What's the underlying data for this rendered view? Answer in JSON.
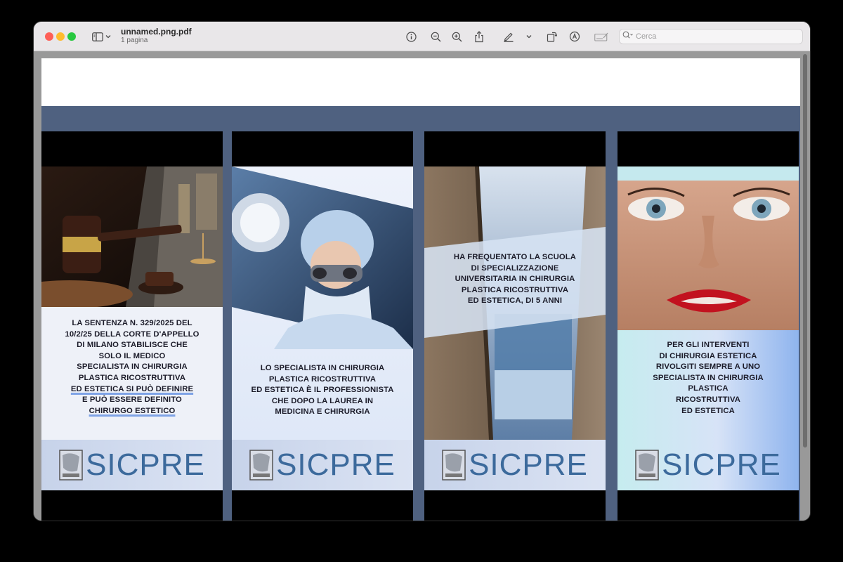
{
  "window": {
    "file_name": "unnamed.png.pdf",
    "page_count": "1 pagina",
    "search_placeholder": "Cerca"
  },
  "toolbar": {
    "icons": [
      "sidebar-icon",
      "chevron-down-icon",
      "info-icon",
      "zoom-out-icon",
      "zoom-in-icon",
      "share-icon",
      "highlight-pen-icon",
      "chevron-down-icon",
      "rotate-icon",
      "markup-icon",
      "signature-icon",
      "search-icon"
    ]
  },
  "document": {
    "panels": [
      {
        "text_lines": [
          "LA SENTENZA N. 329/2025 DEL",
          "10/2/25 DELLA CORTE D'APPELLO",
          "DI MILANO STABILISCE CHE",
          "SOLO IL MEDICO",
          "SPECIALISTA IN CHIRURGIA",
          "PLASTICA RICOSTRUTTIVA",
          "ED ESTETICA SI PUÒ DEFINIRE",
          "E PUÒ ESSERE DEFINITO",
          "CHIRURGO ESTETICO"
        ],
        "logo": "SICPRE"
      },
      {
        "text_lines": [
          "LO SPECIALISTA IN CHIRURGIA",
          "PLASTICA RICOSTRUTTIVA",
          "ED ESTETICA È IL PROFESSIONISTA",
          "CHE DOPO LA LAUREA IN",
          "MEDICINA E CHIRURGIA"
        ],
        "logo": "SICPRE"
      },
      {
        "text_lines": [
          "HA FREQUENTATO LA SCUOLA",
          "DI SPECIALIZZAZIONE",
          "UNIVERSITARIA IN CHIRURGIA",
          "PLASTICA RICOSTRUTTIVA",
          "ED ESTETICA, DI 5 ANNI"
        ],
        "logo": "SICPRE"
      },
      {
        "text_lines": [
          "PER GLI INTERVENTI",
          "DI CHIRURGIA ESTETICA",
          "RIVOLGITI SEMPRE A UNO",
          "SPECIALISTA IN CHIRURGIA",
          "PLASTICA",
          "RICOSTRUTTIVA",
          "ED ESTETICA"
        ],
        "logo": "SICPRE"
      }
    ]
  },
  "colors": {
    "band": "#4f6180",
    "logo_text": "#3c6a9c",
    "accent_underline": "#7fa3e6"
  }
}
